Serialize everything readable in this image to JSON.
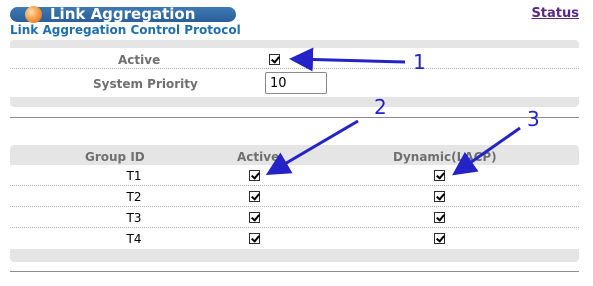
{
  "header": {
    "title": "Link Aggregation",
    "status_link": "Status",
    "subtitle": "Link Aggregation Control Protocol"
  },
  "lacp": {
    "active_label": "Active",
    "active_checked": true,
    "system_priority_label": "System Priority",
    "system_priority_value": "10"
  },
  "groups": {
    "columns": [
      "Group ID",
      "Active",
      "Dynamic(LACP)"
    ],
    "rows": [
      {
        "id": "T1",
        "active": true,
        "dynamic": true
      },
      {
        "id": "T2",
        "active": true,
        "dynamic": true
      },
      {
        "id": "T3",
        "active": true,
        "dynamic": true
      },
      {
        "id": "T4",
        "active": true,
        "dynamic": true
      }
    ]
  },
  "annotations": [
    "1",
    "2",
    "3"
  ],
  "colors": {
    "title_bar": "#2f6aa6",
    "subtitle": "#1f6fb0",
    "status_link": "#5a2a82",
    "annotation": "#2323c8",
    "panel": "#e5e5e5"
  }
}
